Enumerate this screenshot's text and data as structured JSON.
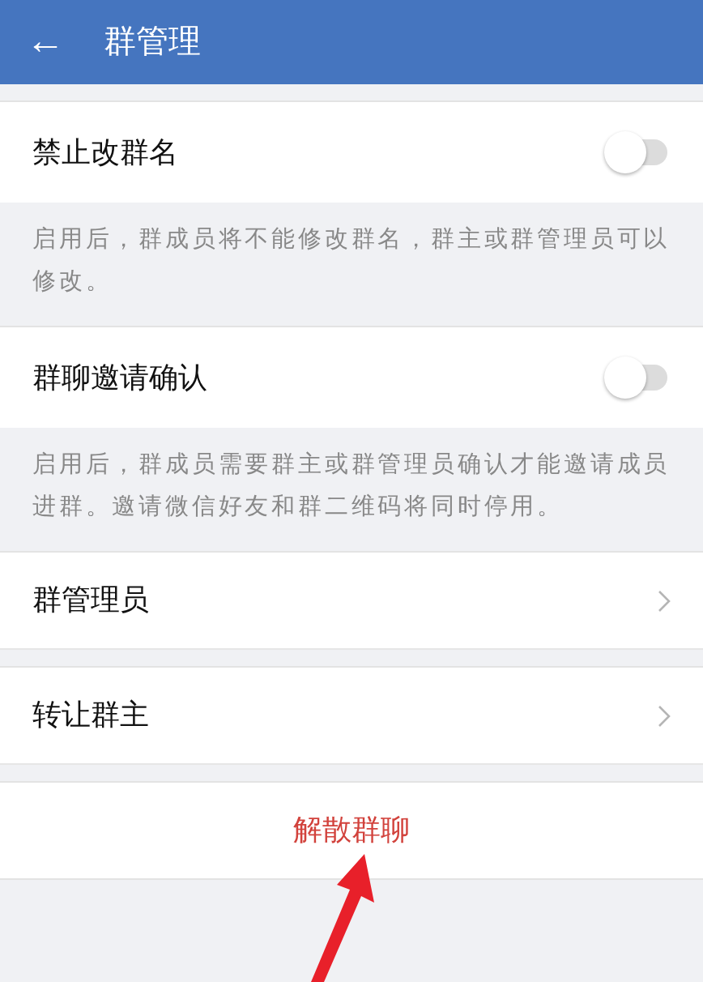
{
  "header": {
    "back_icon": "←",
    "title": "群管理"
  },
  "groups": [
    [
      {
        "kind": "toggle",
        "label": "禁止改群名",
        "on": false
      },
      {
        "kind": "note",
        "text": "启用后，群成员将不能修改群名，群主或群管理员可以修改。"
      },
      {
        "kind": "toggle",
        "label": "群聊邀请确认",
        "on": false
      },
      {
        "kind": "note",
        "text": "启用后，群成员需要群主或群管理员确认才能邀请成员进群。邀请微信好友和群二维码将同时停用。"
      },
      {
        "kind": "link",
        "label": "群管理员"
      }
    ],
    [
      {
        "kind": "link",
        "label": "转让群主"
      }
    ],
    [
      {
        "kind": "action",
        "label": "解散群聊"
      }
    ]
  ]
}
